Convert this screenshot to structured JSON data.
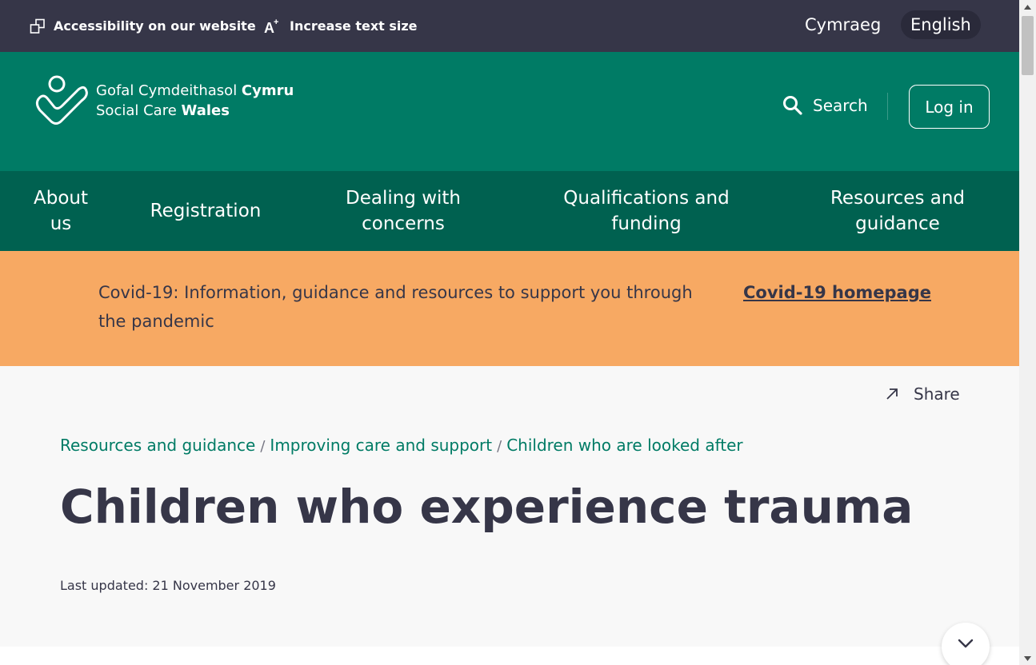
{
  "utility_bar": {
    "accessibility_label": "Accessibility on our website",
    "text_size_label": "Increase text size",
    "languages": [
      {
        "label": "Cymraeg",
        "active": false
      },
      {
        "label": "English",
        "active": true
      }
    ]
  },
  "header": {
    "logo": {
      "line1_regular": "Gofal Cymdeithasol ",
      "line1_bold": "Cymru",
      "line2_regular": "Social Care ",
      "line2_bold": "Wales"
    },
    "search_label": "Search",
    "login_label": "Log in"
  },
  "nav": {
    "items": [
      {
        "label": "About us"
      },
      {
        "label": "Registration"
      },
      {
        "label": "Dealing with concerns"
      },
      {
        "label": "Qualifications and funding"
      },
      {
        "label": "Resources and guidance"
      }
    ]
  },
  "banner": {
    "text": "Covid-19: Information, guidance and resources to support you through the pandemic",
    "link_label": "Covid-19 homepage"
  },
  "content": {
    "share_label": "Share",
    "breadcrumb": [
      {
        "label": "Resources and guidance"
      },
      {
        "label": "Improving care and support"
      },
      {
        "label": "Children who are looked after"
      }
    ],
    "breadcrumb_separator": "/",
    "title": "Children who experience trauma",
    "last_updated": "Last updated: 21 November 2019"
  },
  "colors": {
    "utility_bg": "#363648",
    "header_bg": "#007b65",
    "nav_bg": "#006150",
    "banner_bg": "#f7a963",
    "link_green": "#007b65",
    "text_dark": "#363648"
  },
  "icons": {
    "accessibility": "accessibility-icon",
    "text_size": "text-size-icon",
    "search": "search-icon",
    "share": "share-arrow-icon",
    "scroll_down": "chevron-down-icon"
  }
}
